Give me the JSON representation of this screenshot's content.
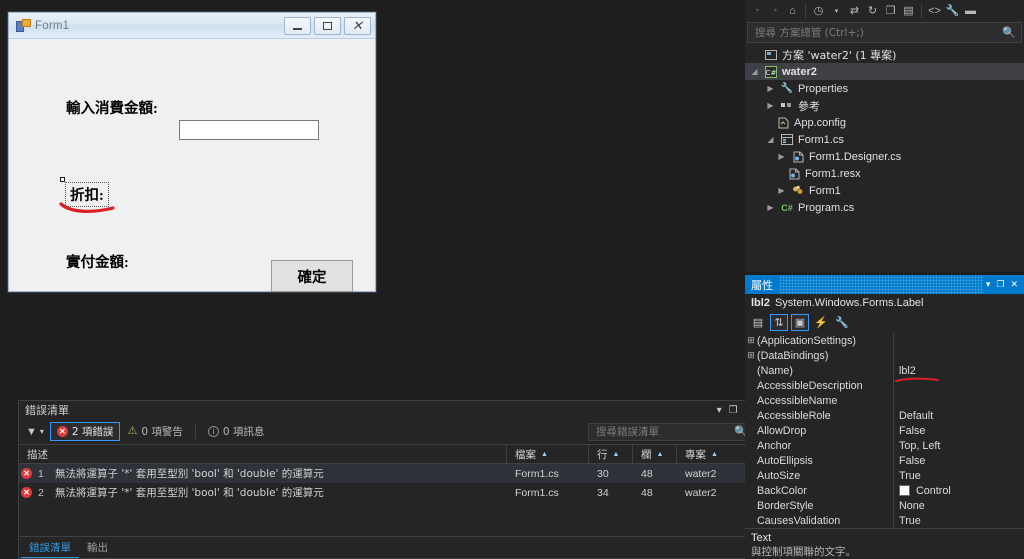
{
  "form": {
    "title": "Form1",
    "window_buttons": {
      "minimize": "minimize-button",
      "maximize": "maximize-button",
      "close": "close-button"
    },
    "labels": {
      "amount": "輸入消費金額:",
      "discount": "折扣:",
      "paid": "實付金額:"
    },
    "textbox_value": "",
    "button_label": "確定"
  },
  "solution_explorer": {
    "search_placeholder": "搜尋 方案總管 (Ctrl+;)",
    "toolbar": [
      "back-icon",
      "forward-icon",
      "home-icon",
      "pending-changes-icon",
      "dropdown-caret-icon",
      "sync-icon",
      "refresh-icon",
      "collapse-all-icon",
      "properties-window-icon",
      "show-all-files-icon",
      "wrench-icon",
      "preview-icon"
    ],
    "tree": [
      {
        "label": "方案 'water2' (1 專案)",
        "icon": "solution-icon",
        "indent": 0,
        "twisty": "",
        "selected": false,
        "bold": false
      },
      {
        "label": "water2",
        "icon": "csharp-project-icon",
        "indent": 1,
        "twisty": "▲",
        "selected": true,
        "bold": true
      },
      {
        "label": "Properties",
        "icon": "wrench-icon",
        "indent": 2,
        "twisty": "▶",
        "selected": false,
        "bold": false
      },
      {
        "label": "參考",
        "icon": "references-icon",
        "indent": 2,
        "twisty": "▶",
        "selected": false,
        "bold": false
      },
      {
        "label": "App.config",
        "icon": "config-file-icon",
        "indent": 3,
        "twisty": "",
        "selected": false,
        "bold": false
      },
      {
        "label": "Form1.cs",
        "icon": "form-file-icon",
        "indent": 2,
        "twisty": "▲",
        "selected": false,
        "bold": false
      },
      {
        "label": "Form1.Designer.cs",
        "icon": "csharp-file-icon",
        "indent": 3,
        "twisty": "▶",
        "selected": false,
        "bold": false
      },
      {
        "label": "Form1.resx",
        "icon": "resx-file-icon",
        "indent": 4,
        "twisty": "",
        "selected": false,
        "bold": false
      },
      {
        "label": "Form1",
        "icon": "class-icon",
        "indent": 3,
        "twisty": "▶",
        "selected": false,
        "bold": false
      },
      {
        "label": "Program.cs",
        "icon": "csharp-file-icon",
        "indent": 2,
        "twisty": "▶",
        "selected": false,
        "bold": false
      }
    ]
  },
  "properties": {
    "panel_title": "屬性",
    "object_name": "lbl2",
    "object_type": "System.Windows.Forms.Label",
    "toolbar": [
      "categorized-icon",
      "alphabetical-icon",
      "properties-icon",
      "events-icon",
      "property-pages-icon"
    ],
    "rows": [
      {
        "expander": "⊞",
        "name": "(ApplicationSettings)",
        "value": "",
        "swatch": ""
      },
      {
        "expander": "⊞",
        "name": "(DataBindings)",
        "value": "",
        "swatch": ""
      },
      {
        "expander": "",
        "name": "(Name)",
        "value": "lbl2",
        "swatch": "",
        "underlined": true
      },
      {
        "expander": "",
        "name": "AccessibleDescription",
        "value": "",
        "swatch": ""
      },
      {
        "expander": "",
        "name": "AccessibleName",
        "value": "",
        "swatch": ""
      },
      {
        "expander": "",
        "name": "AccessibleRole",
        "value": "Default",
        "swatch": ""
      },
      {
        "expander": "",
        "name": "AllowDrop",
        "value": "False",
        "swatch": ""
      },
      {
        "expander": "",
        "name": "Anchor",
        "value": "Top, Left",
        "swatch": ""
      },
      {
        "expander": "",
        "name": "AutoEllipsis",
        "value": "False",
        "swatch": ""
      },
      {
        "expander": "",
        "name": "AutoSize",
        "value": "True",
        "swatch": ""
      },
      {
        "expander": "",
        "name": "BackColor",
        "value": "Control",
        "swatch": "#ffffff"
      },
      {
        "expander": "",
        "name": "BorderStyle",
        "value": "None",
        "swatch": ""
      },
      {
        "expander": "",
        "name": "CausesValidation",
        "value": "True",
        "swatch": ""
      }
    ],
    "footer_key": "Text",
    "footer_desc": "與控制項關聯的文字。",
    "titlebar_icons": [
      "dropdown-caret-icon",
      "maximize-icon",
      "close-icon"
    ]
  },
  "error_list": {
    "panel_title": "錯誤清單",
    "header_icons": [
      "dropdown-caret-icon",
      "maximize-icon",
      "close-icon"
    ],
    "filter_icon": "filter-icon",
    "severity_buttons": [
      {
        "label": "2 項錯誤",
        "icon": "error-icon",
        "active": true
      },
      {
        "label": "0 項警告",
        "icon": "warning-icon",
        "active": false
      },
      {
        "label": "0 項訊息",
        "icon": "info-icon",
        "active": false
      }
    ],
    "search_placeholder": "搜尋錯誤清單",
    "columns": [
      "描述",
      "檔案",
      "行",
      "欄",
      "專案"
    ],
    "rows": [
      {
        "num": "1",
        "icon": "error-icon",
        "description": "無法將運算子 '*' 套用至型別 'bool' 和 'double' 的運算元",
        "file": "Form1.cs",
        "line": "30",
        "column": "48",
        "project": "water2",
        "selected": true
      },
      {
        "num": "2",
        "icon": "error-icon",
        "description": "無法將運算子 '*' 套用至型別 'bool' 和 'double' 的運算元",
        "file": "Form1.cs",
        "line": "34",
        "column": "48",
        "project": "water2",
        "selected": false
      }
    ],
    "tabs": [
      {
        "label": "錯誤清單",
        "active": true
      },
      {
        "label": "輸出",
        "active": false
      }
    ]
  },
  "colors": {
    "accent": "#007acc",
    "error": "#e03a3a",
    "annotation": "#d81f26",
    "background": "#1e1e1e",
    "panel": "#252526"
  }
}
